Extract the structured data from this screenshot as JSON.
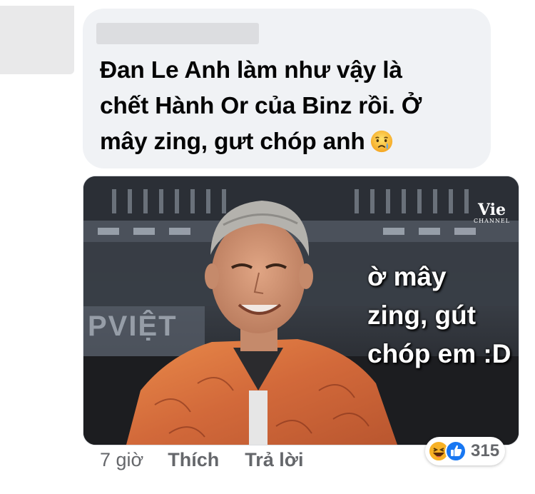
{
  "comment": {
    "text_lines": [
      "Đan Le Anh làm như vậy là",
      "chết Hành Or của Binz rồi. Ở",
      "mây zing, gưt chóp anh"
    ],
    "emoji": "crying-face-icon"
  },
  "media": {
    "watermark_big": "Vie",
    "watermark_small": "CHANNEL",
    "stage_sign": "PVIỆT",
    "caption_lines": [
      "ờ mây",
      "zing, gút",
      "chóp em :D"
    ]
  },
  "actions": {
    "time": "7 giờ",
    "like_label": "Thích",
    "reply_label": "Trả lời"
  },
  "reactions": {
    "icons": [
      "haha-icon",
      "like-icon"
    ],
    "count": "315",
    "colors": {
      "like": "#1877f2",
      "haha": "#f7b125"
    }
  }
}
